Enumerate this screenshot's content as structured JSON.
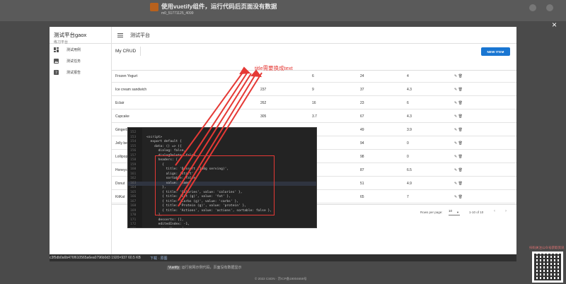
{
  "background": {
    "page_title": "使用vuetify组件，运行代码后页面没有数据",
    "username": "m0_51771125_4099",
    "image_info": "c3f5db0a6b476f610565a6ea0796b0d3   1920×937 60.5 KB",
    "download_label": "下载 · 原图",
    "note_tag": "Vuetify",
    "note_text": "运行官网示例代码，页面没有数据显示",
    "footer_text": "© 2022 CSDN · 京ICP备19004658号",
    "qr_label": "扫码关注公众号获取资讯",
    "close_symbol": "×"
  },
  "app": {
    "brand_title": "测试平台gaox",
    "brand_subtitle": "练习平台",
    "sidebar_items": [
      {
        "label": "测试用例",
        "icon": "dashboard-icon"
      },
      {
        "label": "测试任务",
        "icon": "image-icon"
      },
      {
        "label": "测试报告",
        "icon": "help-icon"
      }
    ],
    "topbar_title": "测试平台",
    "crud_title": "My CRUD",
    "new_item_label": "NEW ITEM",
    "rows": [
      {
        "name": "Frozen Yogurt",
        "calories": "",
        "fat": "6",
        "carbs": "24",
        "protein": "4"
      },
      {
        "name": "Ice cream sandwich",
        "calories": "237",
        "fat": "9",
        "carbs": "37",
        "protein": "4.3"
      },
      {
        "name": "Eclair",
        "calories": "262",
        "fat": "16",
        "carbs": "23",
        "protein": "6"
      },
      {
        "name": "Cupcake",
        "calories": "305",
        "fat": "3.7",
        "carbs": "67",
        "protein": "4.3"
      },
      {
        "name": "Gingerbread",
        "calories": "356",
        "fat": "16",
        "carbs": "49",
        "protein": "3.9"
      },
      {
        "name": "Jelly bean",
        "calories": "",
        "fat": "",
        "carbs": "94",
        "protein": "0"
      },
      {
        "name": "Lollipop",
        "calories": "",
        "fat": "",
        "carbs": "98",
        "protein": "0"
      },
      {
        "name": "Honeycomb",
        "calories": "",
        "fat": "",
        "carbs": "87",
        "protein": "6.5"
      },
      {
        "name": "Donut",
        "calories": "",
        "fat": "",
        "carbs": "51",
        "protein": "4.9"
      },
      {
        "name": "KitKat",
        "calories": "",
        "fat": "",
        "carbs": "65",
        "protein": "7"
      }
    ],
    "row_actions": "✎ 🗑",
    "footer": {
      "rows_per_page_label": "Rows per page:",
      "rows_per_page_value": "10",
      "range_text": "1-10 of 10",
      "prev": "‹",
      "next": "›"
    }
  },
  "code": {
    "lines": [
      {
        "n": "152",
        "t": ""
      },
      {
        "n": "153",
        "t": "<script>"
      },
      {
        "n": "154",
        "t": "  export default {"
      },
      {
        "n": "155",
        "t": "    data: () => ({"
      },
      {
        "n": "156",
        "t": "      dialog: false,"
      },
      {
        "n": "157",
        "t": "      dialogDelete: false,"
      },
      {
        "n": "158",
        "t": "      headers: ["
      },
      {
        "n": "159",
        "t": "        {"
      },
      {
        "n": "160",
        "t": "          title: 'Dessert (100g serving)',"
      },
      {
        "n": "161",
        "t": "          align: 'start',"
      },
      {
        "n": "162",
        "t": "          sortable: false,"
      },
      {
        "n": "163",
        "t": "          value: 'name',"
      },
      {
        "n": "164",
        "t": "        },"
      },
      {
        "n": "165",
        "t": "        { title: 'Calories', value: 'calories' },"
      },
      {
        "n": "166",
        "t": "        { title: 'Fat (g)', value: 'fat' },"
      },
      {
        "n": "167",
        "t": "        { title: 'Carbs (g)', value: 'carbs' },"
      },
      {
        "n": "168",
        "t": "        { title: 'Protein (g)', value: 'protein' },"
      },
      {
        "n": "169",
        "t": "        { title: 'Actions', value: 'actions', sortable: false },"
      },
      {
        "n": "170",
        "t": "      ],"
      },
      {
        "n": "171",
        "t": "      desserts: [],"
      },
      {
        "n": "172",
        "t": "      editedIndex: -1,"
      },
      {
        "n": "173",
        "t": "      editedItem: {"
      }
    ],
    "highlight_line": "163"
  },
  "annotation": {
    "text": "title需要换成text",
    "color": "#e53935"
  },
  "colors": {
    "primary": "#1976d2",
    "annotation": "#e53935"
  }
}
